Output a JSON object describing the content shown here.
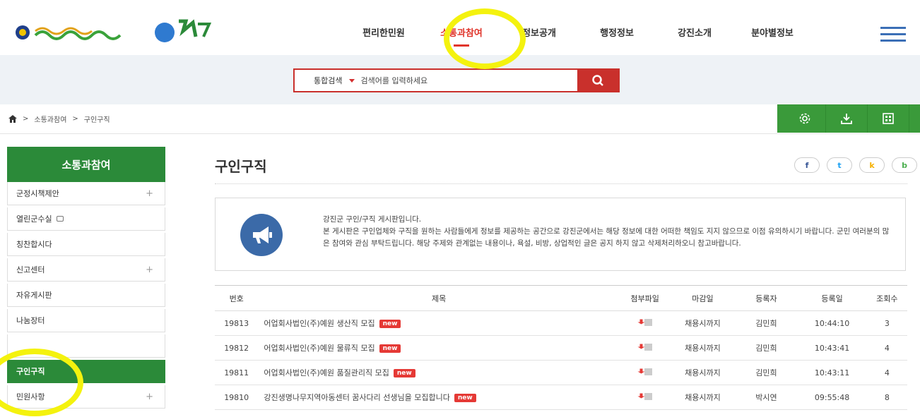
{
  "nav": {
    "items": [
      "편리한민원",
      "소통과참여",
      "정보공개",
      "행정정보",
      "강진소개",
      "분야별정보"
    ],
    "active_index": 1
  },
  "search": {
    "scope": "통합검색",
    "placeholder": "검색어를 입력하세요"
  },
  "breadcrumb": [
    "소통과참여",
    "구인구직"
  ],
  "sidebar": {
    "title": "소통과참여",
    "items": [
      {
        "label": "군정시책제안",
        "expandable": true
      },
      {
        "label": "열린군수실",
        "external": true
      },
      {
        "label": "칭찬합시다"
      },
      {
        "label": "신고센터",
        "expandable": true
      },
      {
        "label": "자유게시판"
      },
      {
        "label": "나눔장터"
      },
      {
        "label": ""
      },
      {
        "label": "구인구직",
        "active": true
      },
      {
        "label": "민원사항",
        "expandable": true
      }
    ]
  },
  "main": {
    "title": "구인구직",
    "sns": [
      "f",
      "t",
      "k",
      "b"
    ],
    "notice": [
      "강진군 구인/구직 게시판입니다.",
      "본 게시판은 구인업체와 구직을 원하는 사람들에게 정보를 제공하는 공간으로 강진군에서는 해당 정보에 대한 어떠한 책임도 지지 않으므로 이점 유의하시기 바랍니다. 군민 여러분의 많은 참여와 관심 부탁드립니다. 해당 주제와 관계없는 내용이나, 욕설, 비방, 상업적인 글은 공지 하지 않고 삭제처리하오니 참고바랍니다."
    ]
  },
  "board": {
    "headers": [
      "번호",
      "제목",
      "첨부파일",
      "마감일",
      "등록자",
      "등록일",
      "조회수"
    ],
    "new_badge": "new",
    "rows": [
      {
        "no": "19813",
        "title": "어업회사법인(주)예원 생산직 모집",
        "deadline": "채용시까지",
        "author": "김민희",
        "date": "10:44:10",
        "views": "3"
      },
      {
        "no": "19812",
        "title": "어업회사법인(주)예원 물류직 모집",
        "deadline": "채용시까지",
        "author": "김민희",
        "date": "10:43:41",
        "views": "4"
      },
      {
        "no": "19811",
        "title": "어업회사법인(주)예원 품질관리직 모집",
        "deadline": "채용시까지",
        "author": "김민희",
        "date": "10:43:11",
        "views": "4"
      },
      {
        "no": "19810",
        "title": "강진생명나무지역아동센터 꿈사다리 선생님을 모집합니다",
        "deadline": "채용시까지",
        "author": "박시연",
        "date": "09:55:48",
        "views": "8"
      }
    ]
  },
  "colors": {
    "brand_green": "#2b8a39",
    "accent_red": "#c9302c",
    "highlight_yellow": "#f4f20e"
  }
}
